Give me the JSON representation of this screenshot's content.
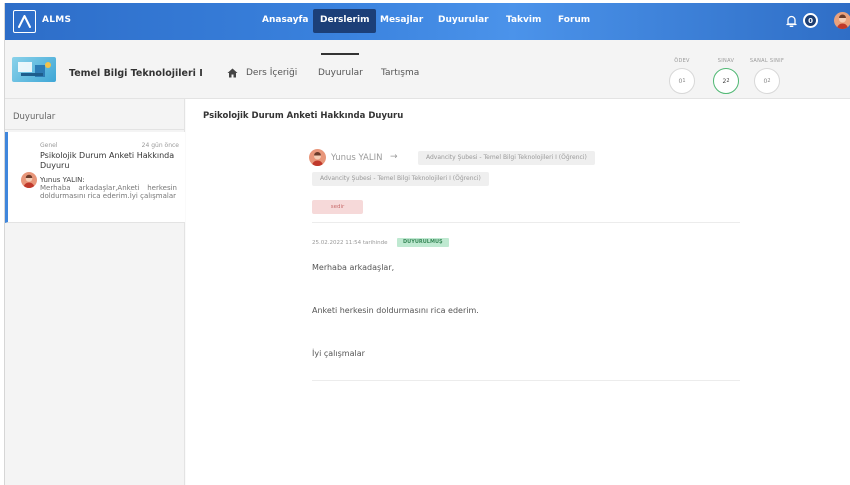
{
  "topbar": {
    "brand": "ALMS",
    "nav": [
      "Anasayfa",
      "Derslerim",
      "Mesajlar",
      "Duyurular",
      "Takvim",
      "Forum"
    ],
    "active_nav": "Derslerim",
    "notification_count": "0"
  },
  "course": {
    "title": "Temel Bilgi Teknolojileri I",
    "tabs": [
      "Ders İçeriği",
      "Duyurular",
      "Tartışma"
    ],
    "active_tab": "Duyurular",
    "stats": [
      {
        "label": "ÖDEV",
        "value": "0",
        "sub": "1"
      },
      {
        "label": "SINAV",
        "value": "2",
        "sub": "2"
      },
      {
        "label": "SANAL SINIF",
        "value": "0",
        "sub": "2"
      }
    ]
  },
  "sidebar": {
    "title": "Duyurular",
    "items": [
      {
        "category": "Genel",
        "time": "24 gün önce",
        "title": "Psikolojik Durum Anketi Hakkında Duyuru",
        "author": "Yunus YALIN:",
        "snippet": "Merhaba arkadaşlar,Anketi herkesin doldurmasını rica ederim.İyi çalışmalar"
      }
    ]
  },
  "main": {
    "title": "Psikolojik Durum Anketi Hakkında Duyuru",
    "poster": "Yunus YALIN",
    "arrow": "→",
    "recipient_1": "Advancity Şubesi - Temel Bilgi Teknolojileri I (Öğrenci)",
    "recipient_2": "Advancity Şubesi - Temel Bilgi Teknolojileri I (Öğrenci)",
    "red_chip": "sedir",
    "date": "25.02.2022 11:54 tarihinde",
    "status": "DUYURULMUŞ",
    "paragraphs": [
      "Merhaba arkadaşlar,",
      "Anketi herkesin doldurmasını rica ederim.",
      "İyi çalışmalar"
    ]
  },
  "colors": {
    "nav_blue": "#3a82de",
    "nav_active": "#1c3f78",
    "accent_green": "#4fb873",
    "sidebar_accent": "#3f86dc"
  }
}
